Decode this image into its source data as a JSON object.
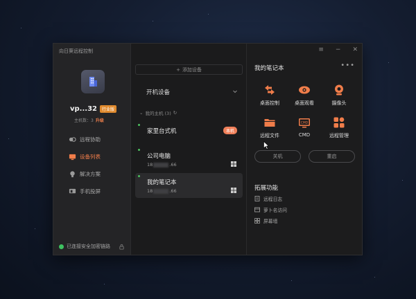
{
  "app": {
    "title": "向日葵远程控制"
  },
  "account": {
    "device_name": "vp...32",
    "plan_badge": "行业版",
    "host_count": "主机数：3",
    "upgrade": "升级"
  },
  "nav": {
    "items": [
      {
        "label": "远程协助",
        "icon": "remote-assist-icon",
        "active": false
      },
      {
        "label": "设备列表",
        "icon": "device-list-icon",
        "active": true
      },
      {
        "label": "解决方案",
        "icon": "solution-icon",
        "active": false
      },
      {
        "label": "手机投屏",
        "icon": "screen-cast-icon",
        "active": false
      }
    ]
  },
  "status": {
    "secure_text": "已连接安全加密链路"
  },
  "middle": {
    "add_device": "添加设备",
    "boot_devices": "开机设备",
    "my_hosts": "我的主机 (3)",
    "hosts": [
      {
        "name": "家里台式机",
        "ip_prefix": "",
        "ip_suffix": "",
        "badge": "本机",
        "online": true,
        "selected": false
      },
      {
        "name": "公司电脑",
        "ip_prefix": "18",
        "ip_suffix": ".66",
        "badge": "",
        "online": true,
        "selected": false
      },
      {
        "name": "我的笔记本",
        "ip_prefix": "18",
        "ip_suffix": ".66",
        "badge": "",
        "online": true,
        "selected": true
      }
    ]
  },
  "detail": {
    "title": "我的笔记本",
    "more": "•••",
    "functions": [
      {
        "label": "桌面控制",
        "icon": "desktop-control-icon"
      },
      {
        "label": "桌面观看",
        "icon": "desktop-view-icon"
      },
      {
        "label": "摄像头",
        "icon": "camera-icon"
      },
      {
        "label": "远程文件",
        "icon": "remote-file-icon"
      },
      {
        "label": "CMD",
        "icon": "cmd-icon"
      },
      {
        "label": "远程管理",
        "icon": "remote-manage-icon"
      }
    ],
    "shutdown": "关机",
    "restart": "重启",
    "extensions_title": "拓展功能",
    "extensions": [
      {
        "label": "远程日志",
        "icon": "log-icon"
      },
      {
        "label": "萝卜名访问",
        "icon": "domain-access-icon"
      },
      {
        "label": "屏幕墙",
        "icon": "screen-wall-icon"
      }
    ]
  },
  "colors": {
    "accent": "#f07d4a",
    "online": "#3ec160",
    "badge": "#e08a2e"
  }
}
